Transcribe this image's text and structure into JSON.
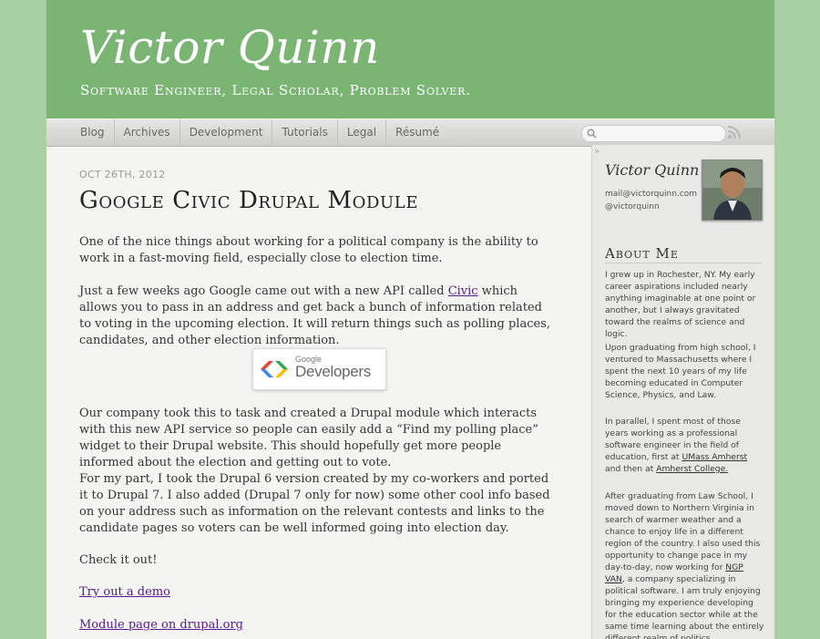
{
  "header": {
    "site_title": "Victor Quinn",
    "tagline": "Software Engineer, Legal Scholar, Problem Solver."
  },
  "nav": {
    "items": [
      "Blog",
      "Archives",
      "Development",
      "Tutorials",
      "Legal",
      "Résumé"
    ],
    "search_placeholder": "",
    "search_icon": "search-icon",
    "rss_icon": "rss-icon"
  },
  "post": {
    "date": "OCT 26TH, 2012",
    "title": "Google Civic Drupal Module",
    "p1": "One of the nice things about working for a political company is the ability to work in a fast-moving field, especially close to election time.",
    "p2_before": "Just a few weeks ago Google came out with a new API called ",
    "p2_link": "Civic",
    "p2_after": " which allows you to pass in an address and get back a bunch of information related to voting in the upcoming election. It will return things such as polling places, candidates, and other election information.",
    "image_google": "Google",
    "image_developers": "Developers",
    "p3": "Our company took this to task and created a Drupal module which interacts with this new API service so people can easily add a “Find my polling place” widget to their Drupal website. This should hopefully get more people informed about the election and getting out to vote.",
    "p4": "For my part, I took the Drupal 6 version created by my co-workers and ported it to Drupal 7. I also added (Drupal 7 only for now) some other cool info based on your address such as information on the relevant contests and links to the candidate pages so voters can be well informed going into election day.",
    "p5": "Check it out!",
    "link_demo": "Try out a demo",
    "link_module": "Module page on drupal.org"
  },
  "sidebar": {
    "collapse_glyph": "»",
    "name": "Victor Quinn",
    "email": "mail@victorquinn.com",
    "handle": "@victorquinn",
    "about_heading": "About Me",
    "about_p1": "I grew up in Rochester, NY. My early career aspirations included nearly anything imaginable at one point or another, but I always gravitated toward the realms of science and logic.",
    "about_p2": "Upon graduating from high school, I ventured to Massachusetts where I spent the next 10 years of my life becoming educated in Computer Science, Physics, and Law.",
    "about_p3_before": "In parallel, I spent most of those years working as a professional software engineer in the field of education, first at ",
    "about_p3_link1": "UMass Amherst",
    "about_p3_mid": " and then at ",
    "about_p3_link2": "Amherst College.",
    "about_p4_before": "After graduating from Law School, I moved down to Northern Virginia in search of warmer weather and a chance to enjoy life in a different region of the country. I also used this opportunity to change pace in my day-to-day, now working for ",
    "about_p4_link": "NGP VAN",
    "about_p4_after": ", a company specializing in political software. I am truly enjoying bringing my experience developing for the education sector while at the same time learning about the entirely different realm of politics."
  },
  "colors": {
    "header_green": "#7ab574",
    "background_green": "#a9cfa5",
    "link_purple": "#551a8b"
  }
}
